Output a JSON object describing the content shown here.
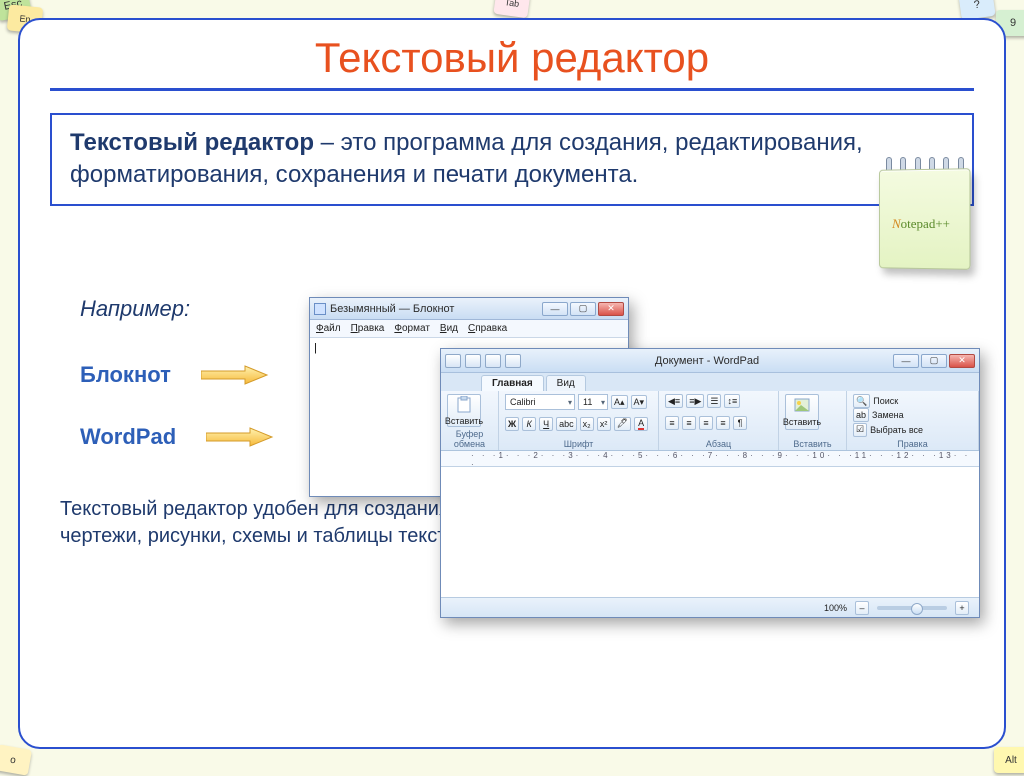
{
  "slide": {
    "title": "Текстовый редактор",
    "definition_bold": "Текстовый редактор",
    "definition_rest": " – это программа для создания, редактирования, форматирования, сохранения и печати документа.",
    "example_label": "Например:",
    "app1": "Блокнот",
    "app2": "WordPad",
    "bottom_text": "Текстовый редактор удобен для создания небольших сообщений и текстов. Фотографии, чертежи, рисунки, схемы и таблицы текстовый редактор обрабатывать не может.",
    "notepad_logo": "Notepad++"
  },
  "notepad": {
    "title": "Безымянный — Блокнот",
    "menu": [
      "Файл",
      "Правка",
      "Формат",
      "Вид",
      "Справка"
    ],
    "content": "|",
    "btn_min": "—",
    "btn_max": "▢",
    "btn_close": "✕"
  },
  "wordpad": {
    "title": "Документ - WordPad",
    "tabs": {
      "home": "Главная",
      "view": "Вид"
    },
    "groups": {
      "clipboard": "Буфер обмена",
      "font": "Шрифт",
      "paragraph": "Абзац",
      "insert_g": "Вставить",
      "edit": "Правка"
    },
    "paste": "Вставить",
    "font_name": "Calibri",
    "font_size": "11",
    "insert_btn": "Вставить",
    "find": "Поиск",
    "replace": "Замена",
    "select_all": "Выбрать все",
    "ruler": "· · ·1· · ·2· · ·3· · ·4· · ·5· · ·6· · ·7· · ·8· · ·9· · ·10· · ·11· · ·12· · ·13· · ·",
    "zoom": "100%",
    "zoom_minus": "–",
    "zoom_plus": "+",
    "btn_min": "—",
    "btn_max": "▢",
    "btn_close": "✕"
  },
  "keys": {
    "esc": "Esc",
    "en": "En",
    "tab": "Tab",
    "q": "?",
    "nine": "9",
    "o": "o",
    "alt": "Alt"
  }
}
